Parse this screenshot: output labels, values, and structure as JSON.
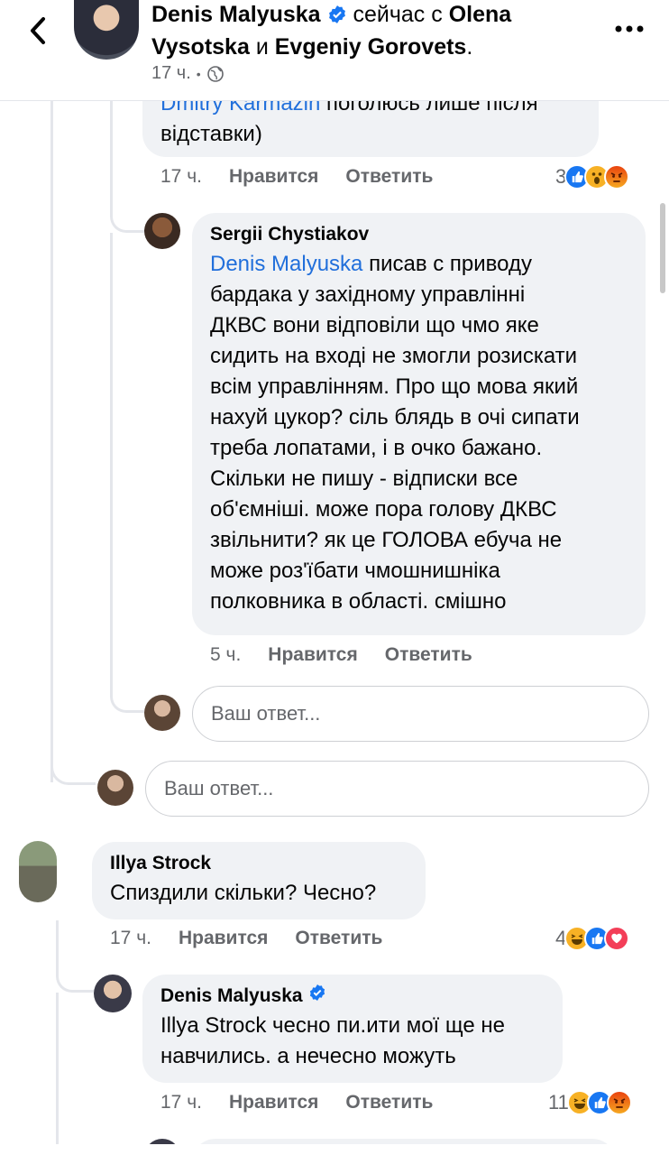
{
  "header": {
    "author": "Denis Malyuska",
    "with_text": "сейчас с",
    "tag1": "Olena Vysotska",
    "and_text": "и",
    "tag2": "Evgeniy Gorovets",
    "period": ".",
    "time": "17 ч.",
    "dot": "•"
  },
  "comment_top": {
    "mention": "Dmitry Karmazin",
    "text_line1": "поголюсь лише після",
    "text_line2": "відставки)",
    "time": "17 ч.",
    "like_label": "Нравится",
    "reply_label": "Ответить",
    "reaction_count": "3",
    "reactions": [
      "like-icon",
      "wow-icon",
      "angry-icon"
    ]
  },
  "comment_sergii": {
    "name": "Sergii Chystiakov",
    "mention": "Denis Malyuska",
    "text_first": " писав с приводу",
    "lines": [
      "бардака у західному управлінні",
      "ДКВС вони відповіли що чмо яке",
      "сидить на вході не змогли розискати",
      "всім управлінням. Про що мова який",
      "нахуй цукор? сіль блядь в очі сипати",
      "треба лопатами, і в очко бажано.",
      "Скільки не пишу - відписки все",
      "об'ємніші. може пора голову ДКВС",
      "звільнити? як це ГОЛОВА ебуча не",
      "може роз'їбати чмошнишніка",
      "полковника в області. смішно"
    ],
    "time": "5 ч.",
    "like_label": "Нравится",
    "reply_label": "Ответить"
  },
  "reply_input_1": {
    "placeholder": "Ваш ответ..."
  },
  "reply_input_2": {
    "placeholder": "Ваш ответ..."
  },
  "comment_illya": {
    "name": "Illya Strock",
    "text": "Спиздили скільки? Чесно?",
    "time": "17 ч.",
    "like_label": "Нравится",
    "reply_label": "Ответить",
    "reaction_count": "4",
    "reactions": [
      "haha-icon",
      "like-icon",
      "love-icon"
    ]
  },
  "comment_denis_reply": {
    "name": "Denis Malyuska",
    "line1": "Illya Strock чесно пи.ити мої ще не",
    "line2": "навчились. а нечесно можуть",
    "time": "17 ч.",
    "like_label": "Нравится",
    "reply_label": "Ответить",
    "reaction_count": "11",
    "reactions": [
      "haha-icon",
      "like-icon",
      "angry-icon"
    ]
  },
  "colors": {
    "link": "#216fdb",
    "secondary_text": "#65676b",
    "bubble_bg": "#f0f2f5",
    "verified_blue": "#1877f2",
    "like_blue": "#1877f2",
    "love_red": "#f33e58",
    "angry_orange": "#e9710f",
    "haha_yellow": "#f7b125"
  }
}
